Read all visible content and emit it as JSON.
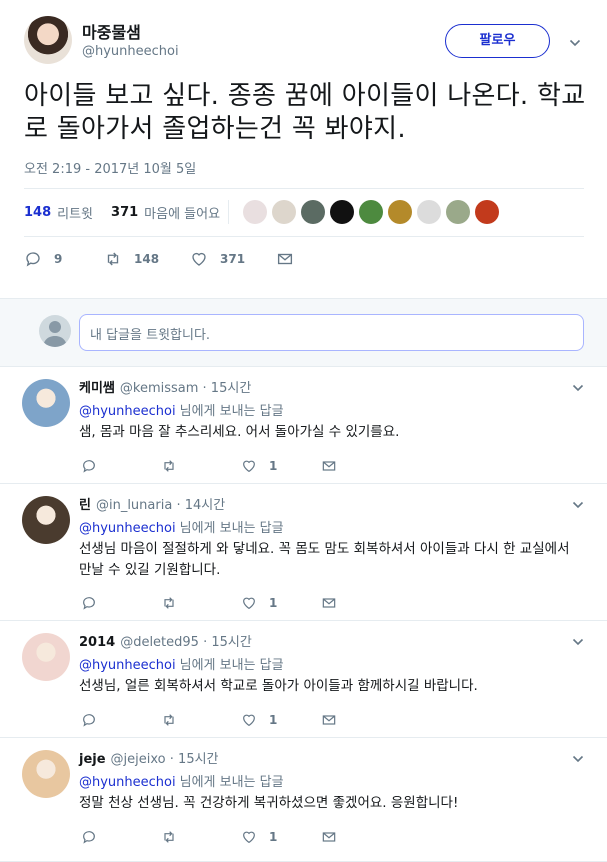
{
  "tweet": {
    "author_name": "마중물샘",
    "author_handle": "@hyunheechoi",
    "follow_label": "팔로우",
    "text": "아이들 보고 싶다. 종종 꿈에 아이들이 나온다. 학교로 돌아가서 졸업하는건 꼭 봐야지.",
    "timestamp": "오전 2:19 - 2017년 10월 5일",
    "retweets_count": "148",
    "retweets_label": "리트윗",
    "likes_count": "371",
    "likes_label": "마음에 들어요",
    "reply_count": "9",
    "retweet_action_count": "148",
    "like_action_count": "371",
    "liker_colors": [
      "#e9dfe0",
      "#ddd6cc",
      "#5b6b63",
      "#111111",
      "#4d8a3f",
      "#b48a2a",
      "#dcdcdc",
      "#9aa98a",
      "#c23a1c"
    ]
  },
  "reply_box": {
    "placeholder": "내 답글을 트윗합니다."
  },
  "replies": [
    {
      "name": "케미쌤",
      "handle": "@kemissam",
      "time": "· 15시간",
      "to_handle": "@hyunheechoi",
      "to_suffix": "님에게 보내는 답글",
      "text": "샘, 몸과 마음 잘 추스리세요. 어서 돌아가실 수 있기를요.",
      "reply_count": "",
      "retweet_count": "",
      "like_count": "1",
      "avatar_color": "#7ea4c9"
    },
    {
      "name": "린",
      "handle": "@in_lunaria",
      "time": "· 14시간",
      "to_handle": "@hyunheechoi",
      "to_suffix": "님에게 보내는 답글",
      "text": "선생님 마음이 절절하게 와 닿네요. 꼭 몸도 맘도 회복하셔서 아이들과 다시 한 교실에서 만날 수 있길 기원합니다.",
      "reply_count": "",
      "retweet_count": "",
      "like_count": "1",
      "avatar_color": "#4a3b2e"
    },
    {
      "name": "2014",
      "handle": "@deleted95",
      "time": "· 15시간",
      "to_handle": "@hyunheechoi",
      "to_suffix": "님에게 보내는 답글",
      "text": "선생님, 얼른 회복하셔서 학교로 돌아가 아이들과 함께하시길 바랍니다.",
      "reply_count": "",
      "retweet_count": "",
      "like_count": "1",
      "avatar_color": "#f1d6d0"
    },
    {
      "name": "jeje",
      "handle": "@jejeixo",
      "time": "· 15시간",
      "to_handle": "@hyunheechoi",
      "to_suffix": "님에게 보내는 답글",
      "text": "정말 천상 선생님. 꼭 건강하게 복귀하셨으면 좋겠어요. 응원합니다!",
      "reply_count": "",
      "retweet_count": "",
      "like_count": "1",
      "avatar_color": "#e8c7a0"
    }
  ]
}
